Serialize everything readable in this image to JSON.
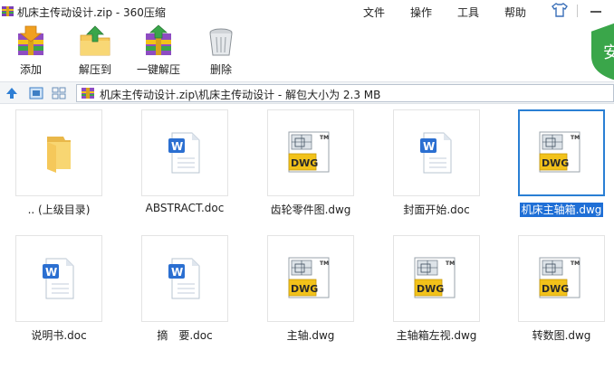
{
  "window": {
    "title": "机床主传动设计.zip - 360压缩",
    "menus": [
      "文件",
      "操作",
      "工具",
      "帮助"
    ],
    "badge_char": "安"
  },
  "toolbar": {
    "add_label": "添加",
    "extract_label": "解压到",
    "one_click_label": "一键解压",
    "delete_label": "删除"
  },
  "addressbar": {
    "path": "机床主传动设计.zip\\机床主传动设计 - 解包大小为 2.3 MB"
  },
  "files": [
    {
      "name": ".. (上级目录)",
      "type": "folder",
      "selected": false
    },
    {
      "name": "ABSTRACT.doc",
      "type": "doc",
      "selected": false
    },
    {
      "name": "齿轮零件图.dwg",
      "type": "dwg",
      "selected": false
    },
    {
      "name": "封面开始.doc",
      "type": "doc",
      "selected": false
    },
    {
      "name": "机床主轴箱.dwg",
      "type": "dwg",
      "selected": true
    },
    {
      "name": "说明书.doc",
      "type": "doc",
      "selected": false
    },
    {
      "name": "摘　要.doc",
      "type": "doc",
      "selected": false
    },
    {
      "name": "主轴.dwg",
      "type": "dwg",
      "selected": false
    },
    {
      "name": "主轴箱左视.dwg",
      "type": "dwg",
      "selected": false
    },
    {
      "name": "转数图.dwg",
      "type": "dwg",
      "selected": false
    }
  ],
  "icons": {
    "dwg_text": "DWG",
    "dwg_tm": "TM",
    "doc_letter": "W"
  },
  "colors": {
    "accent": "#2a7fd4",
    "selection": "#1f6fd6",
    "folder": "#f5c85a",
    "dwg_yellow": "#f2c21a",
    "word_blue": "#2b6fd1",
    "badge_green": "#3aa64a"
  }
}
